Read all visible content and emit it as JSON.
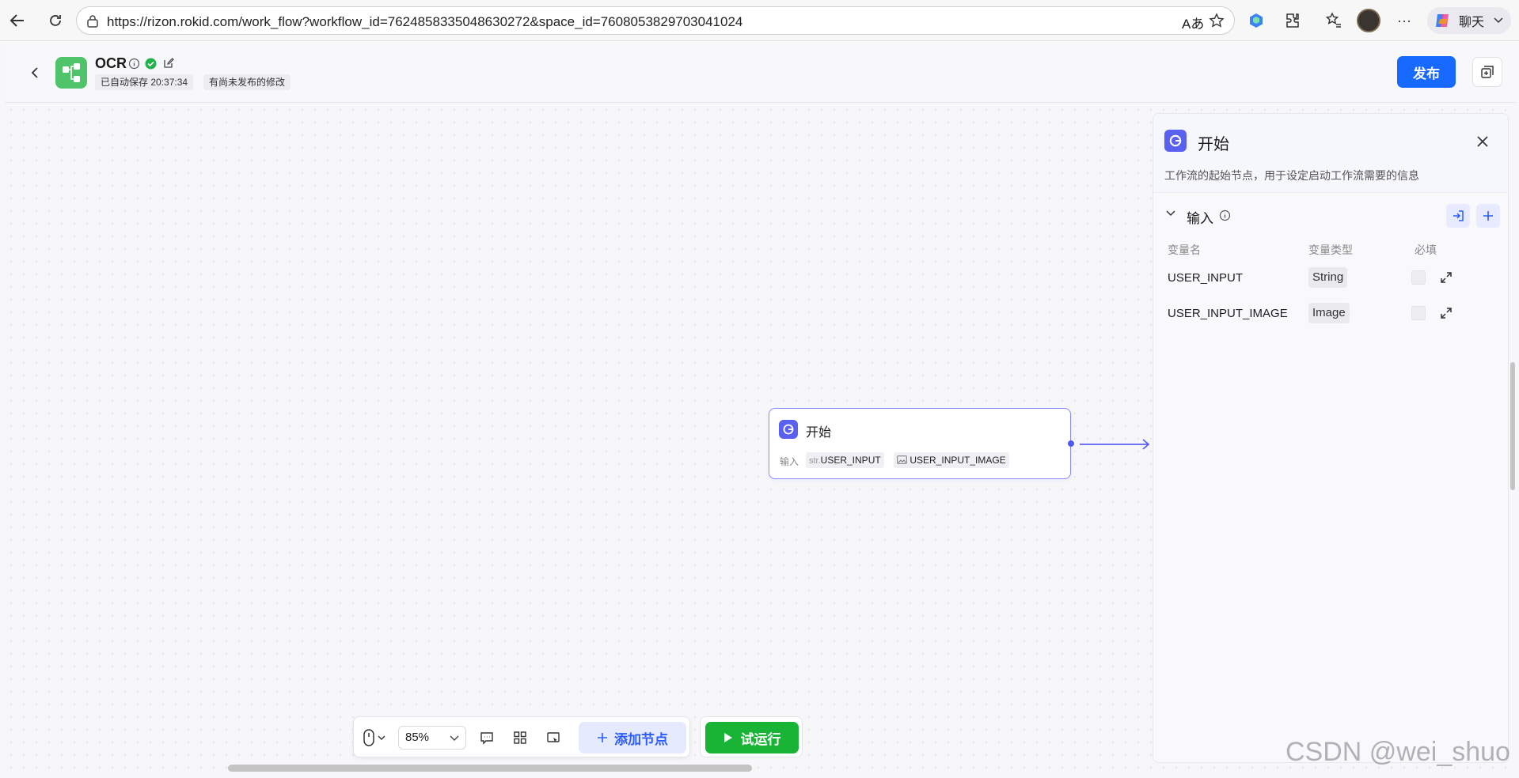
{
  "browser": {
    "url": "https://rizon.rokid.com/work_flow?workflow_id=7624858335048630272&space_id=7608053829703041024",
    "chat_label": "聊天",
    "icons": [
      "back-arrow-icon",
      "refresh-icon",
      "lock-icon",
      "translate-icon",
      "star-icon",
      "extension-icon",
      "favorites-icon",
      "avatar",
      "more-icon",
      "copilot-icon"
    ]
  },
  "header": {
    "title": "OCR",
    "autosave": "已自动保存 20:37:34",
    "unpublished": "有尚未发布的修改",
    "publish_label": "发布",
    "brand_color": "#4fc36a",
    "accent_color": "#1769ff"
  },
  "node": {
    "title": "开始",
    "input_label": "输入",
    "chips": [
      {
        "prefix": "str.",
        "name": "USER_INPUT"
      },
      {
        "name": "USER_INPUT_IMAGE"
      }
    ]
  },
  "panel": {
    "title": "开始",
    "description": "工作流的起始节点，用于设定启动工作流需要的信息",
    "section_label": "输入",
    "columns": [
      "变量名",
      "变量类型",
      "必填"
    ],
    "rows": [
      {
        "name": "USER_INPUT",
        "type": "String"
      },
      {
        "name": "USER_INPUT_IMAGE",
        "type": "Image"
      }
    ]
  },
  "toolbar": {
    "zoom": "85%",
    "add_node_label": "添加节点",
    "run_label": "试运行",
    "run_color": "#19b436"
  },
  "watermark": "CSDN @wei_shuo"
}
